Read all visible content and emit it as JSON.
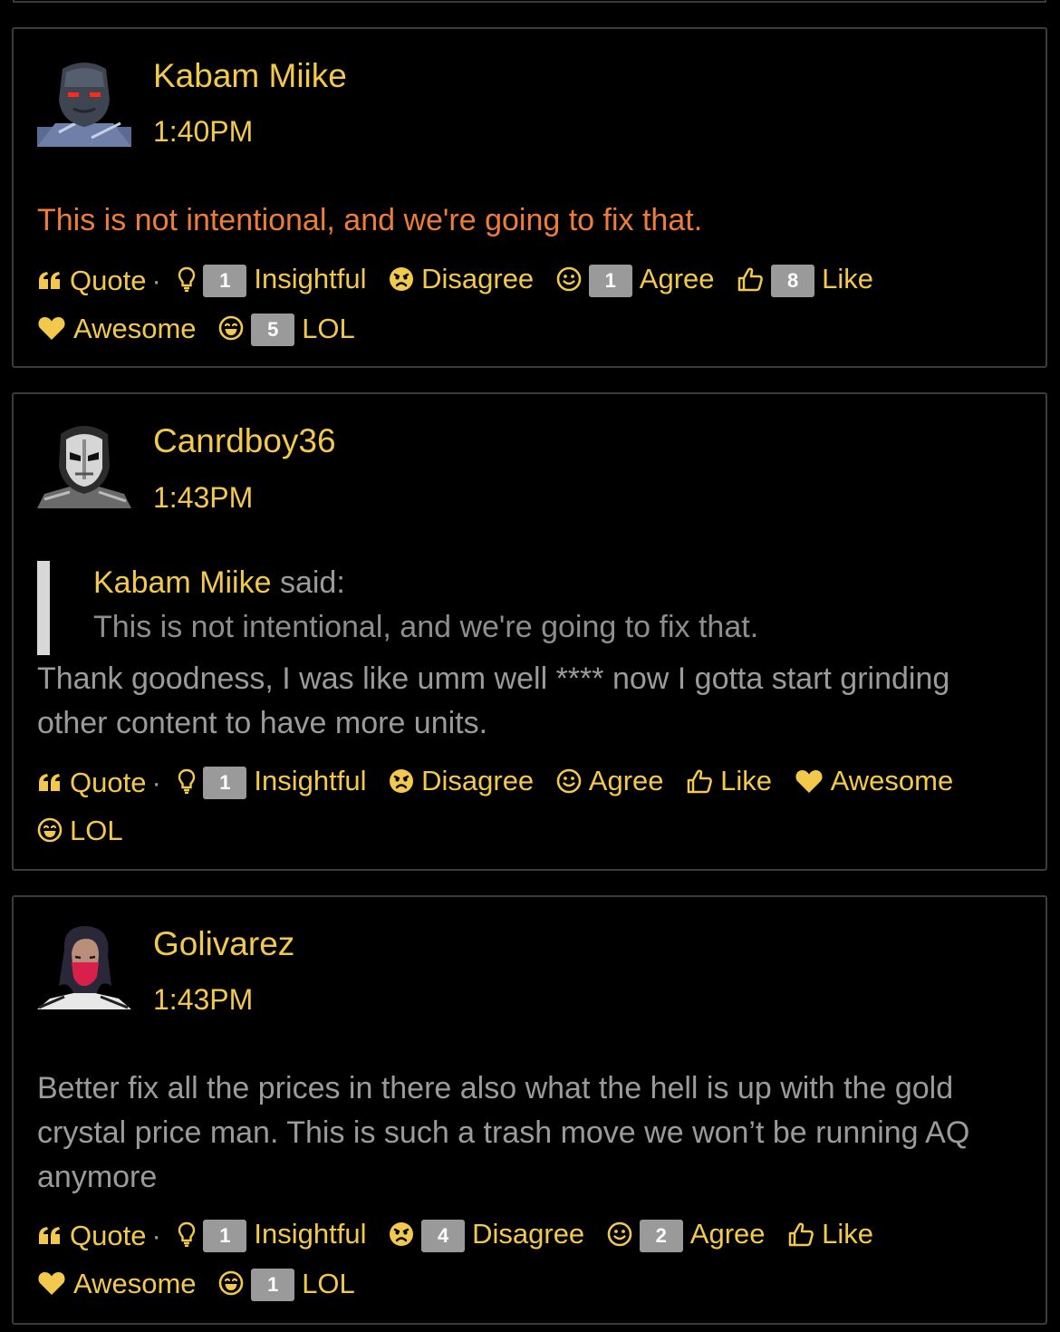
{
  "theme": {
    "accent": "#f2c94c",
    "staff_text": "#ee7d3a",
    "muted_text": "#9b9b9b",
    "badge_bg": "#9a9a9a",
    "background": "#000000"
  },
  "posts": [
    {
      "author": "Kabam Miike",
      "time": "1:40PM",
      "avatar_icon": "darkseid-avatar",
      "body": "This is not intentional, and we're going to fix that.",
      "reactions": {
        "quote": "Quote",
        "insightful": {
          "label": "Insightful",
          "count": "1"
        },
        "disagree": {
          "label": "Disagree",
          "count": ""
        },
        "agree": {
          "label": "Agree",
          "count": "1"
        },
        "like": {
          "label": "Like",
          "count": "8"
        },
        "awesome": {
          "label": "Awesome",
          "count": ""
        },
        "lol": {
          "label": "LOL",
          "count": "5"
        }
      }
    },
    {
      "author": "Canrdboy36",
      "time": "1:43PM",
      "avatar_icon": "crossbones-avatar",
      "quote": {
        "author": "Kabam Miike",
        "said": "said:",
        "text": "This is not intentional, and we're going to fix that."
      },
      "body": "Thank goodness, I was like umm well **** now I gotta start grinding other content to have more units.",
      "reactions": {
        "quote": "Quote",
        "insightful": {
          "label": "Insightful",
          "count": "1"
        },
        "disagree": {
          "label": "Disagree",
          "count": ""
        },
        "agree": {
          "label": "Agree",
          "count": ""
        },
        "like": {
          "label": "Like",
          "count": ""
        },
        "awesome": {
          "label": "Awesome",
          "count": ""
        },
        "lol": {
          "label": "LOL",
          "count": ""
        }
      }
    },
    {
      "author": "Golivarez",
      "time": "1:43PM",
      "avatar_icon": "silk-avatar",
      "body": "Better fix all the prices in there also what the hell is up with the gold crystal price man. This is such a trash move we won’t be running AQ anymore",
      "reactions": {
        "quote": "Quote",
        "insightful": {
          "label": "Insightful",
          "count": "1"
        },
        "disagree": {
          "label": "Disagree",
          "count": "4"
        },
        "agree": {
          "label": "Agree",
          "count": "2"
        },
        "like": {
          "label": "Like",
          "count": ""
        },
        "awesome": {
          "label": "Awesome",
          "count": ""
        },
        "lol": {
          "label": "LOL",
          "count": "1"
        }
      }
    }
  ]
}
